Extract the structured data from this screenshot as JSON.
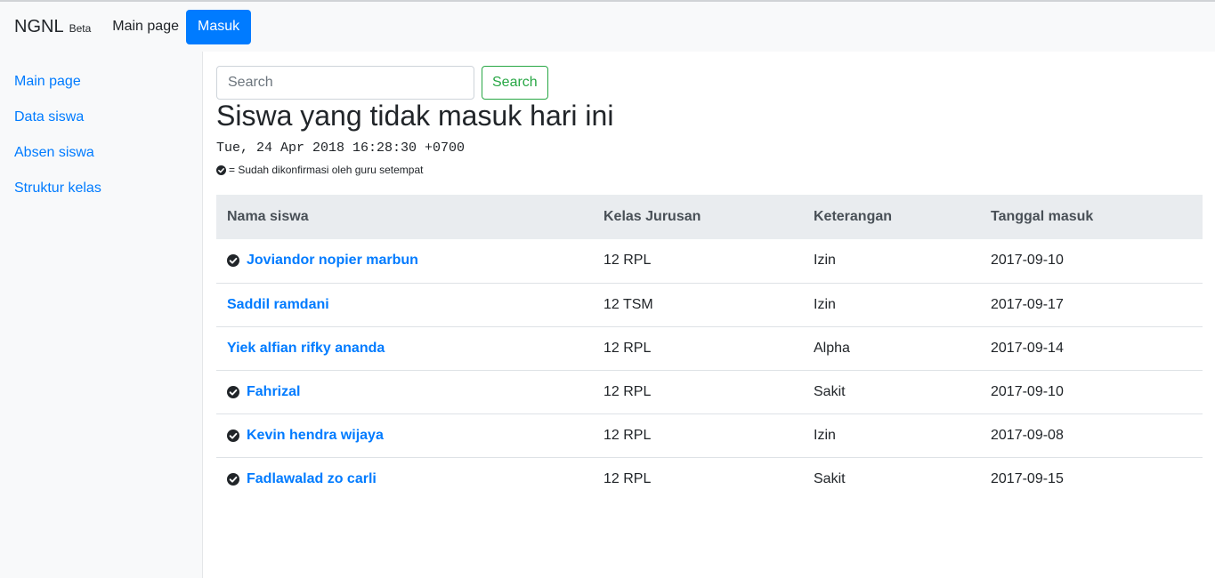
{
  "navbar": {
    "brand": "NGNL",
    "brand_badge": "Beta",
    "main_page": "Main page",
    "masuk": "Masuk"
  },
  "sidebar": {
    "items": [
      {
        "label": "Main page"
      },
      {
        "label": "Data siswa"
      },
      {
        "label": "Absen siswa"
      },
      {
        "label": "Struktur kelas"
      }
    ]
  },
  "search": {
    "placeholder": "Search",
    "value": "",
    "button": "Search"
  },
  "page": {
    "title": "Siswa yang tidak masuk hari ini",
    "timestamp": "Tue, 24 Apr 2018 16:28:30 +0700",
    "legend_text": "= Sudah dikonfirmasi oleh guru setempat"
  },
  "table": {
    "headers": [
      "Nama siswa",
      "Kelas Jurusan",
      "Keterangan",
      "Tanggal masuk"
    ],
    "rows": [
      {
        "confirmed": true,
        "name": "Joviandor nopier marbun",
        "kelas": "12 RPL",
        "keterangan": "Izin",
        "tanggal": "2017-09-10"
      },
      {
        "confirmed": false,
        "name": "Saddil ramdani",
        "kelas": "12 TSM",
        "keterangan": "Izin",
        "tanggal": "2017-09-17"
      },
      {
        "confirmed": false,
        "name": "Yiek alfian rifky ananda",
        "kelas": "12 RPL",
        "keterangan": "Alpha",
        "tanggal": "2017-09-14"
      },
      {
        "confirmed": true,
        "name": "Fahrizal",
        "kelas": "12 RPL",
        "keterangan": "Sakit",
        "tanggal": "2017-09-10"
      },
      {
        "confirmed": true,
        "name": "Kevin hendra wijaya",
        "kelas": "12 RPL",
        "keterangan": "Izin",
        "tanggal": "2017-09-08"
      },
      {
        "confirmed": true,
        "name": "Fadlawalad zo carli",
        "kelas": "12 RPL",
        "keterangan": "Sakit",
        "tanggal": "2017-09-15"
      }
    ]
  },
  "icons": {
    "confirmed": "check-circle-icon"
  },
  "colors": {
    "link": "#007bff",
    "primary_button": "#007bff",
    "success_outline": "#28a745",
    "table_header_bg": "#e9ecef",
    "sidebar_bg": "#f8f9fa"
  }
}
